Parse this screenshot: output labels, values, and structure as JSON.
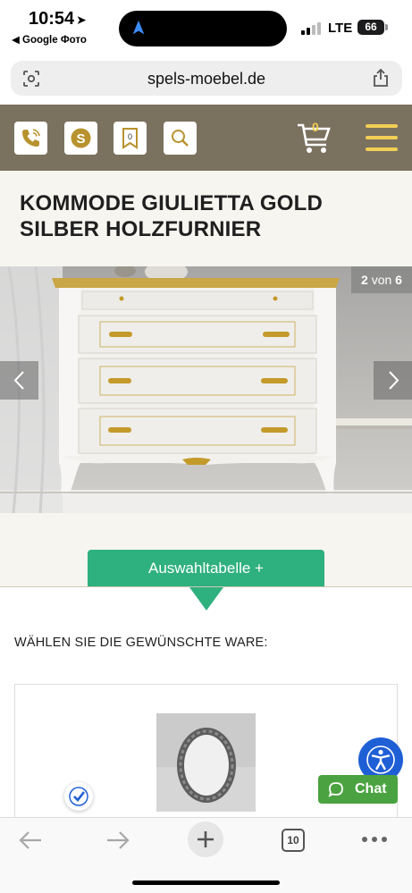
{
  "status_bar": {
    "time": "10:54",
    "back_label": "◀ Google Фото",
    "network": "LTE",
    "battery": "66"
  },
  "browser": {
    "url": "spels-moebel.de",
    "tab_count": "10"
  },
  "site_header": {
    "cart_count": "0",
    "accent_color": "#f2cf55",
    "header_color": "#7b715f",
    "icons": [
      "phone-icon",
      "skype-icon",
      "bookmark-icon",
      "search-icon",
      "cart-icon",
      "menu-icon"
    ]
  },
  "product": {
    "title": "KOMMODE GIULIETTA GOLD SILBER HOLZFURNIER"
  },
  "gallery": {
    "current": "2",
    "of": "von",
    "total": "6"
  },
  "selection": {
    "tab_label": "Auswahltabelle +",
    "choose_label": "WÄHLEN SIE DIE GEWÜNSCHTE WARE:",
    "accent_color": "#2fb07f"
  },
  "chat": {
    "label": "Chat"
  }
}
